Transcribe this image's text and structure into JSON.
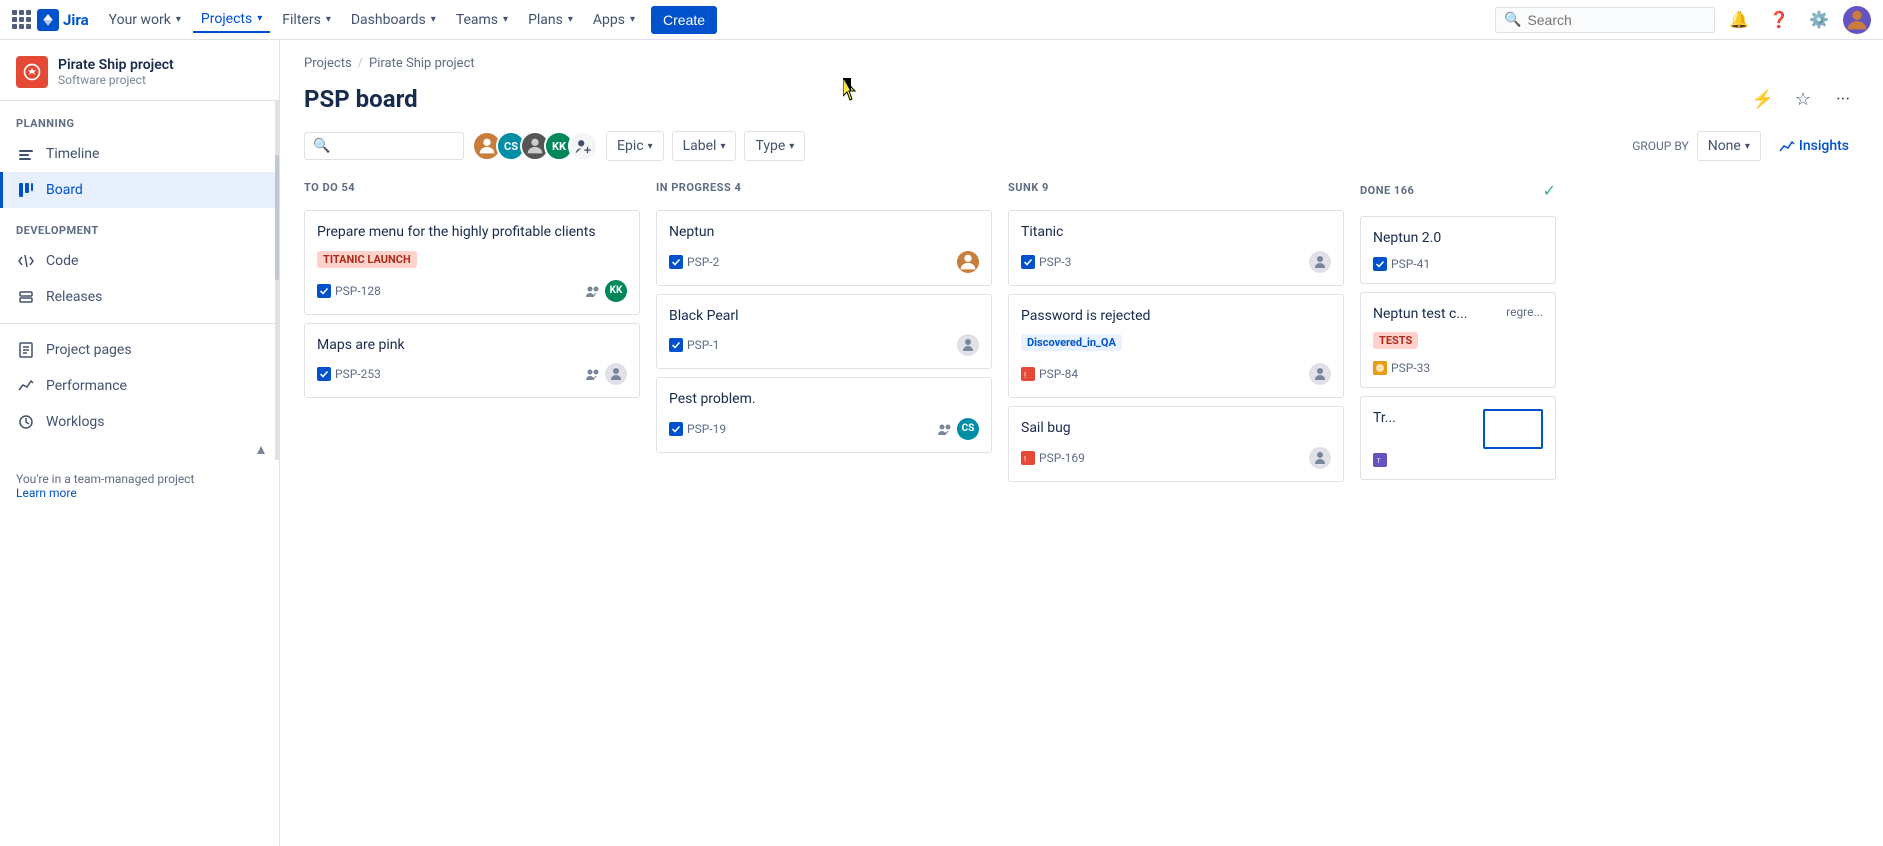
{
  "topnav": {
    "app_grid_label": "App switcher",
    "logo_text": "Jira",
    "nav_items": [
      {
        "id": "your-work",
        "label": "Your work",
        "has_chevron": true,
        "active": false
      },
      {
        "id": "projects",
        "label": "Projects",
        "has_chevron": true,
        "active": true
      },
      {
        "id": "filters",
        "label": "Filters",
        "has_chevron": true,
        "active": false
      },
      {
        "id": "dashboards",
        "label": "Dashboards",
        "has_chevron": true,
        "active": false
      },
      {
        "id": "teams",
        "label": "Teams",
        "has_chevron": true,
        "active": false
      },
      {
        "id": "plans",
        "label": "Plans",
        "has_chevron": true,
        "active": false
      },
      {
        "id": "apps",
        "label": "Apps",
        "has_chevron": true,
        "active": false
      }
    ],
    "create_label": "Create",
    "search_placeholder": "Search"
  },
  "sidebar": {
    "project_name": "Pirate Ship project",
    "project_type": "Software project",
    "planning_label": "PLANNING",
    "development_label": "DEVELOPMENT",
    "planning_items": [
      {
        "id": "timeline",
        "label": "Timeline",
        "icon": "timeline-icon"
      },
      {
        "id": "board",
        "label": "Board",
        "icon": "board-icon",
        "active": true
      }
    ],
    "development_items": [
      {
        "id": "code",
        "label": "Code",
        "icon": "code-icon"
      },
      {
        "id": "releases",
        "label": "Releases",
        "icon": "releases-icon"
      }
    ],
    "other_items": [
      {
        "id": "project-pages",
        "label": "Project pages",
        "icon": "pages-icon"
      },
      {
        "id": "performance",
        "label": "Performance",
        "icon": "performance-icon"
      },
      {
        "id": "worklogs",
        "label": "Worklogs",
        "icon": "worklogs-icon"
      }
    ],
    "team_managed_text": "You're in a team-managed project",
    "learn_more_label": "Learn more"
  },
  "breadcrumb": {
    "projects_label": "Projects",
    "separator": "/",
    "project_label": "Pirate Ship project"
  },
  "board": {
    "title": "PSP board",
    "filters": {
      "search_placeholder": "",
      "avatars": [
        {
          "id": "av1",
          "color": "#c97d3a",
          "initials": ""
        },
        {
          "id": "av2",
          "color": "#008da6",
          "initials": "CS"
        },
        {
          "id": "av3",
          "color": "#555",
          "initials": ""
        },
        {
          "id": "av4",
          "color": "#00875a",
          "initials": "KK"
        }
      ],
      "add_member_label": "+",
      "epic_label": "Epic",
      "label_label": "Label",
      "type_label": "Type",
      "group_by_label": "GROUP BY",
      "group_by_value": "None",
      "insights_label": "Insights"
    },
    "columns": [
      {
        "id": "todo",
        "title": "TO DO 54",
        "done": false,
        "cards": [
          {
            "id": "c1",
            "title": "Prepare menu for the highly profitable clients",
            "badge": {
              "text": "TITANIC LAUNCH",
              "type": "titanic"
            },
            "issue_type": "story",
            "issue_key": "PSP-128",
            "avatar": {
              "type": "teal-kk",
              "text": "KK",
              "color": "#00875a"
            },
            "has_team_icon": true
          },
          {
            "id": "c2",
            "title": "Maps are pink",
            "badge": null,
            "issue_type": "story",
            "issue_key": "PSP-253",
            "avatar": {
              "type": "gray",
              "text": ""
            },
            "has_team_icon": true
          }
        ]
      },
      {
        "id": "inprogress",
        "title": "IN PROGRESS 4",
        "done": false,
        "cards": [
          {
            "id": "c3",
            "title": "Neptun",
            "badge": null,
            "issue_type": "story",
            "issue_key": "PSP-2",
            "avatar": {
              "type": "photo-woman",
              "text": ""
            },
            "has_team_icon": false
          },
          {
            "id": "c4",
            "title": "Black Pearl",
            "badge": null,
            "issue_type": "story",
            "issue_key": "PSP-1",
            "avatar": {
              "type": "gray",
              "text": ""
            },
            "has_team_icon": false
          },
          {
            "id": "c5",
            "title": "Pest problem.",
            "badge": null,
            "issue_type": "story",
            "issue_key": "PSP-19",
            "avatar": {
              "type": "cs",
              "text": "CS",
              "color": "#008da6"
            },
            "has_team_icon": true
          }
        ]
      },
      {
        "id": "sunk",
        "title": "SUNK 9",
        "done": false,
        "cards": [
          {
            "id": "c6",
            "title": "Titanic",
            "badge": null,
            "issue_type": "story",
            "issue_key": "PSP-3",
            "avatar": {
              "type": "gray",
              "text": ""
            },
            "has_team_icon": false
          },
          {
            "id": "c7",
            "title": "Password is rejected",
            "badge": {
              "text": "Discovered_in_QA",
              "type": "discovered"
            },
            "issue_type": "bug",
            "issue_key": "PSP-84",
            "avatar": {
              "type": "gray",
              "text": ""
            },
            "has_team_icon": false
          },
          {
            "id": "c8",
            "title": "Sail bug",
            "badge": null,
            "issue_type": "bug",
            "issue_key": "PSP-169",
            "avatar": {
              "type": "gray",
              "text": ""
            },
            "has_team_icon": false
          }
        ]
      },
      {
        "id": "done",
        "title": "DONE 166",
        "done": true,
        "cards": [
          {
            "id": "c9",
            "title": "Neptun 2.0",
            "badge": null,
            "issue_type": "story",
            "issue_key": "PSP-41",
            "avatar": {
              "type": "gray",
              "text": ""
            },
            "has_team_icon": false
          },
          {
            "id": "c10",
            "title": "Neptun test c...",
            "badge": {
              "text": "TESTS",
              "type": "tests"
            },
            "issue_type": "story",
            "issue_key": "PSP-33",
            "partial_text": "regre...",
            "avatar": {
              "type": "orange-bug",
              "text": ""
            },
            "has_team_icon": false
          },
          {
            "id": "c11",
            "title": "Tr...",
            "badge": null,
            "issue_type": "task",
            "issue_key": "",
            "avatar": {
              "type": "gray",
              "text": ""
            },
            "has_team_icon": false
          }
        ]
      }
    ]
  }
}
